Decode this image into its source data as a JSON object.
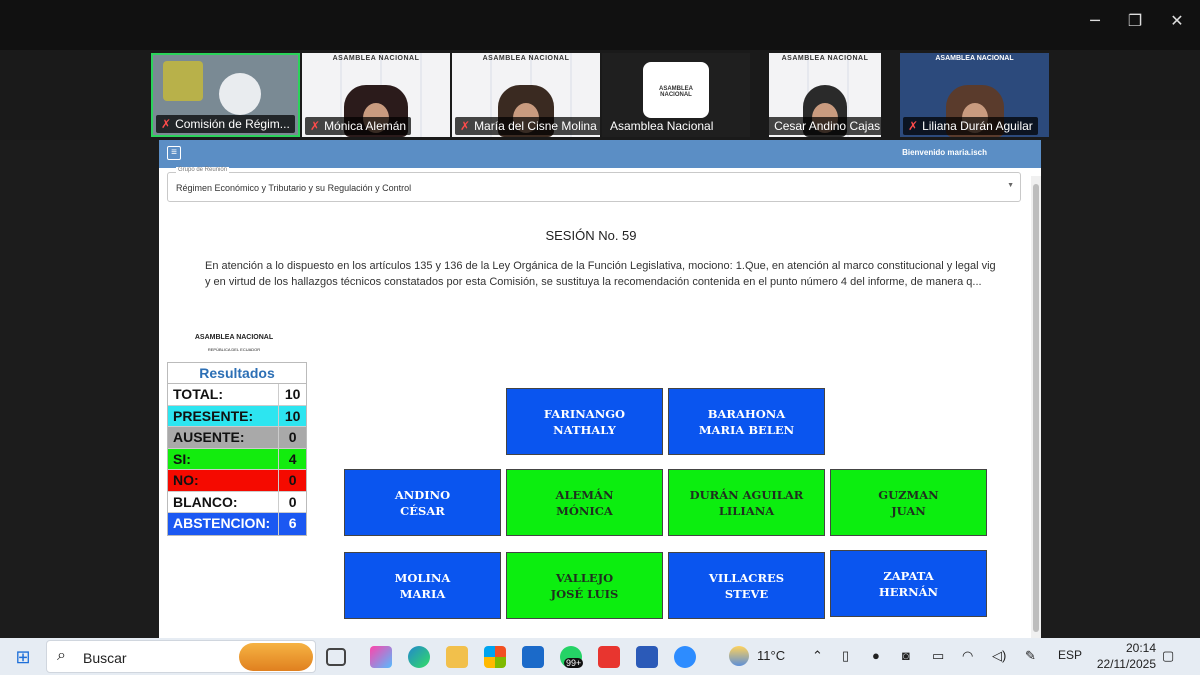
{
  "participants": [
    {
      "name": "Comisión de Régim...",
      "muted": true
    },
    {
      "name": "Mónica Alemán",
      "muted": true
    },
    {
      "name": "María del Cisne Molina",
      "muted": true
    },
    {
      "name": "Asamblea Nacional",
      "muted": false
    },
    {
      "name": "Cesar Andino Cajas",
      "muted": true
    },
    {
      "name": "Liliana Durán Aguilar",
      "muted": true
    }
  ],
  "tile_logo": "ASAMBLEA NACIONAL",
  "app": {
    "welcome": "Bienvenido maria.isch",
    "group_legend": "Grupo de Reunión",
    "group_value": "Régimen Económico y Tributario y su Regulación y Control",
    "session_title": "SESIÓN No. 59",
    "motion_line1": "En atención a lo dispuesto en los artículos 135 y 136 de la Ley Orgánica de la Función Legislativa, mociono: 1.Que, en atención al marco constitucional y legal vigente,",
    "motion_line2": "y en virtud de los hallazgos técnicos constatados por esta Comisión, se sustituya la recomendación contenida en el punto número 4 del informe, de manera q...",
    "org_name": "ASAMBLEA NACIONAL",
    "org_sub": "REPÚBLICA DEL ECUADOR"
  },
  "results": {
    "title": "Resultados",
    "rows": [
      {
        "label": "TOTAL:",
        "value": "10"
      },
      {
        "label": "PRESENTE:",
        "value": "10"
      },
      {
        "label": "AUSENTE:",
        "value": "0"
      },
      {
        "label": "SI:",
        "value": "4"
      },
      {
        "label": "NO:",
        "value": "0"
      },
      {
        "label": "BLANCO:",
        "value": "0"
      },
      {
        "label": "ABSTENCION:",
        "value": "6"
      }
    ],
    "colors": {
      "presente": "#2de5f0",
      "ausente": "#a9a9a9",
      "si": "#13ec0e",
      "no": "#f50a00",
      "abstencion": "#1b58f2"
    }
  },
  "seats": [
    {
      "l1": "FARINANGO",
      "l2": "NATHALY",
      "vote": "abstencion"
    },
    {
      "l1": "BARAHONA",
      "l2": "MARIA BELEN",
      "vote": "abstencion"
    },
    {
      "l1": "ANDINO",
      "l2": "CÉSAR",
      "vote": "abstencion"
    },
    {
      "l1": "ALEMÁN",
      "l2": "MÓNICA",
      "vote": "si"
    },
    {
      "l1": "DURÁN AGUILAR",
      "l2": "LILIANA",
      "vote": "si"
    },
    {
      "l1": "GUZMAN",
      "l2": "JUAN",
      "vote": "si"
    },
    {
      "l1": "MOLINA",
      "l2": "MARIA",
      "vote": "abstencion"
    },
    {
      "l1": "VALLEJO",
      "l2": "JOSÉ LUIS",
      "vote": "si"
    },
    {
      "l1": "VILLACRES",
      "l2": "STEVE",
      "vote": "abstencion"
    },
    {
      "l1": "ZAPATA",
      "l2": "HERNÁN",
      "vote": "abstencion"
    }
  ],
  "taskbar": {
    "search_placeholder": "Buscar",
    "badge": "99+",
    "temperature": "11°C",
    "language": "ESP",
    "time": "20:14",
    "date": "22/11/2025"
  }
}
